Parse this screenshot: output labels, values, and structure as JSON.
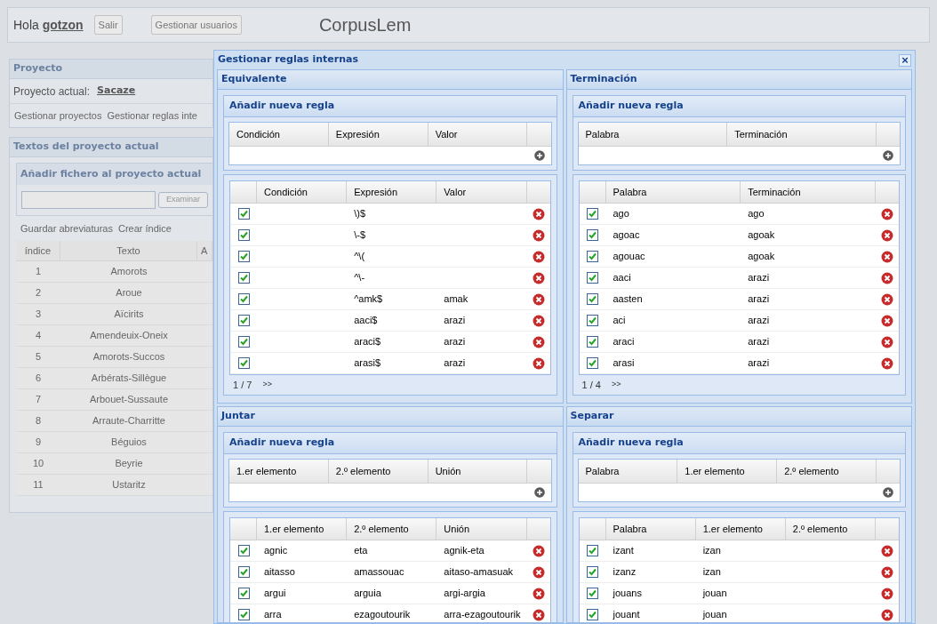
{
  "header": {
    "greeting": "Hola",
    "user": "gotzon",
    "buttons": [
      "Salir",
      "Gestionar usuarios"
    ],
    "app_title": "CorpusLem"
  },
  "project_panel": {
    "title": "Proyecto",
    "current_label": "Proyecto actual:",
    "current_project": "Sacaze",
    "links": [
      "Gestionar proyectos",
      "Gestionar reglas inte"
    ]
  },
  "texts_panel": {
    "title": "Textos del proyecto actual",
    "upload": {
      "title": "Añadir fichero al proyecto actual",
      "button": "Examinar"
    },
    "links": [
      "Guardar abreviaturas",
      "Crear índice"
    ],
    "columns": [
      "índice",
      "Texto",
      "A"
    ],
    "rows": [
      [
        "1",
        "Amorots"
      ],
      [
        "2",
        "Aroue"
      ],
      [
        "3",
        "Aïcirits"
      ],
      [
        "4",
        "Amendeuix-Oneix"
      ],
      [
        "5",
        "Amorots-Succos"
      ],
      [
        "6",
        "Arbérats-Sillègue"
      ],
      [
        "7",
        "Arbouet-Sussaute"
      ],
      [
        "8",
        "Arraute-Charritte"
      ],
      [
        "9",
        "Béguios"
      ],
      [
        "10",
        "Beyrie"
      ],
      [
        "11",
        "Ustaritz"
      ]
    ]
  },
  "dialog": {
    "title": "Gestionar reglas internas",
    "close": "×",
    "sections": [
      {
        "title": "Equivalente",
        "add": {
          "title": "Añadir nueva regla",
          "columns": [
            "Condición",
            "Expresión",
            "Valor"
          ]
        },
        "list": {
          "columns": [
            "Condición",
            "Expresión",
            "Valor"
          ],
          "rows": [
            {
              "checked": true,
              "cells": [
                null,
                "\\)$",
                null
              ]
            },
            {
              "checked": true,
              "cells": [
                null,
                "\\-$",
                null
              ]
            },
            {
              "checked": true,
              "cells": [
                null,
                "^\\(",
                null
              ]
            },
            {
              "checked": true,
              "cells": [
                null,
                "^\\-",
                null
              ]
            },
            {
              "checked": true,
              "cells": [
                null,
                "^amk$",
                "amak"
              ]
            },
            {
              "checked": true,
              "cells": [
                null,
                "aaci$",
                "arazi"
              ]
            },
            {
              "checked": true,
              "cells": [
                null,
                "araci$",
                "arazi"
              ]
            },
            {
              "checked": true,
              "cells": [
                null,
                "arasi$",
                "arazi"
              ]
            }
          ],
          "pager": "1 / 7",
          "next": ">>"
        }
      },
      {
        "title": "Terminación",
        "add": {
          "title": "Añadir nueva regla",
          "columns": [
            "Palabra",
            "Terminación"
          ]
        },
        "list": {
          "columns": [
            "Palabra",
            "Terminación"
          ],
          "rows": [
            {
              "checked": true,
              "cells": [
                "ago",
                "ago"
              ]
            },
            {
              "checked": true,
              "cells": [
                "agoac",
                "agoak"
              ]
            },
            {
              "checked": true,
              "cells": [
                "agouac",
                "agoak"
              ]
            },
            {
              "checked": true,
              "cells": [
                "aaci",
                "arazi"
              ]
            },
            {
              "checked": true,
              "cells": [
                "aasten",
                "arazi"
              ]
            },
            {
              "checked": true,
              "cells": [
                "aci",
                "arazi"
              ]
            },
            {
              "checked": true,
              "cells": [
                "araci",
                "arazi"
              ]
            },
            {
              "checked": true,
              "cells": [
                "arasi",
                "arazi"
              ]
            }
          ],
          "pager": "1 / 4",
          "next": ">>"
        }
      },
      {
        "title": "Juntar",
        "add": {
          "title": "Añadir nueva regla",
          "columns": [
            "1.er elemento",
            "2.º elemento",
            "Unión"
          ]
        },
        "list": {
          "columns": [
            "1.er elemento",
            "2.º elemento",
            "Unión"
          ],
          "rows": [
            {
              "checked": true,
              "cells": [
                "agnic",
                "eta",
                "agnik-eta"
              ]
            },
            {
              "checked": true,
              "cells": [
                "aitasso",
                "amassouac",
                "aitaso-amasuak"
              ]
            },
            {
              "checked": true,
              "cells": [
                "argui",
                "arguia",
                "argi-argia"
              ]
            },
            {
              "checked": true,
              "cells": [
                "arra",
                "ezagoutourik",
                "arra-ezagoutourik"
              ]
            }
          ]
        }
      },
      {
        "title": "Separar",
        "add": {
          "title": "Añadir nueva regla",
          "columns": [
            "Palabra",
            "1.er elemento",
            "2.º elemento"
          ]
        },
        "list": {
          "columns": [
            "Palabra",
            "1.er elemento",
            "2.º elemento"
          ],
          "rows": [
            {
              "checked": true,
              "cells": [
                "izant",
                "izan",
                null
              ]
            },
            {
              "checked": true,
              "cells": [
                "izanz",
                "izan",
                null
              ]
            },
            {
              "checked": true,
              "cells": [
                "jouans",
                "jouan",
                null
              ]
            },
            {
              "checked": true,
              "cells": [
                "jouant",
                "jouan",
                null
              ]
            }
          ]
        }
      }
    ]
  }
}
